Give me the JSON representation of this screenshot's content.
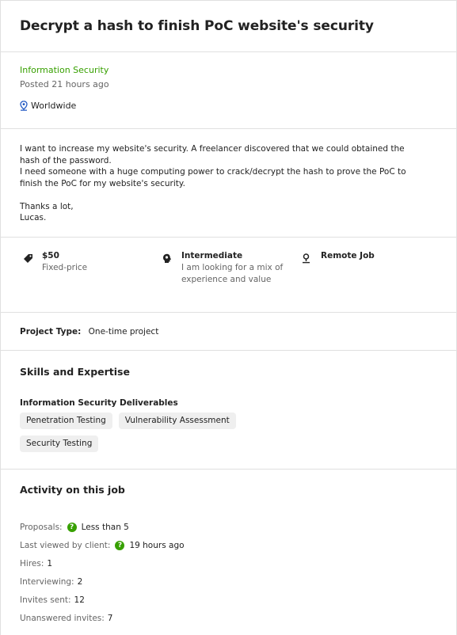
{
  "job": {
    "title": "Decrypt a hash to finish PoC website's security",
    "category": "Information Security",
    "posted": "Posted 21 hours ago",
    "location": "Worldwide",
    "description": "I want to increase my website's security. A freelancer discovered that we could obtained the\nhash of the password.\nI need someone with a huge computing power to crack/decrypt the hash to prove the PoC to\nfinish the PoC for my website's security.\n\nThanks a lot,\nLucas."
  },
  "features": [
    {
      "icon": "price-tag-icon",
      "title": "$50",
      "sub": "Fixed-price"
    },
    {
      "icon": "brain-icon",
      "title": "Intermediate",
      "sub": "I am looking for a mix of\nexperience and value"
    },
    {
      "icon": "person-pin-icon",
      "title": "Remote Job",
      "sub": ""
    }
  ],
  "project_type": {
    "label": "Project Type:",
    "value": "One-time project"
  },
  "skills": {
    "heading": "Skills and Expertise",
    "group": "Information Security Deliverables",
    "tags": [
      "Penetration Testing",
      "Vulnerability Assessment",
      "Security Testing"
    ]
  },
  "activity": {
    "heading": "Activity on this job",
    "proposals_label": "Proposals:",
    "proposals_value": "Less than 5",
    "last_viewed_label": "Last viewed by client:",
    "last_viewed_value": "19 hours ago",
    "hires_label": "Hires:",
    "hires_value": "1",
    "interviewing_label": "Interviewing:",
    "interviewing_value": "2",
    "invites_label": "Invites sent:",
    "invites_value": "12",
    "unanswered_label": "Unanswered invites:",
    "unanswered_value": "7"
  },
  "colors": {
    "accent": "#37a000",
    "muted": "#656565",
    "location_icon": "#1f57c3"
  }
}
